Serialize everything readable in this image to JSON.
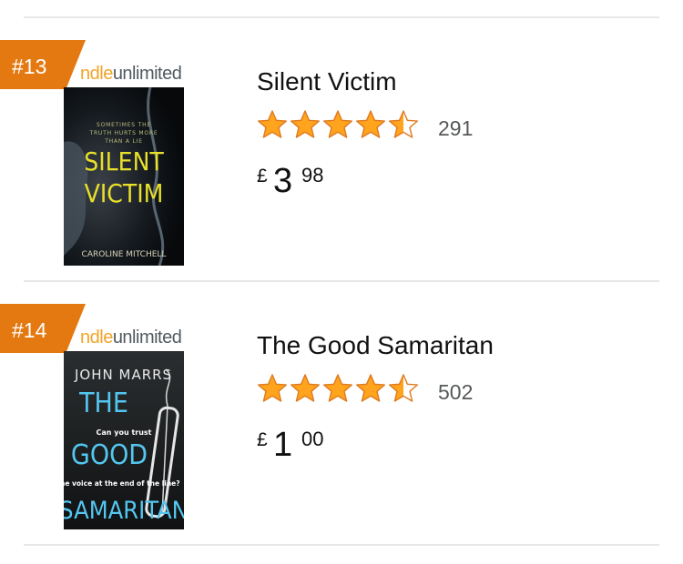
{
  "items": [
    {
      "rank": "#13",
      "kindle_unlimited": {
        "part1": "ndle",
        "part2": "unlimited"
      },
      "title": "Silent Victim",
      "rating_stars": 4.5,
      "rating_count": "291",
      "price": {
        "currency": "£",
        "whole": "3",
        "fraction": "98"
      },
      "cover": {
        "tagline": [
          "SOMETIMES THE",
          "TRUTH HURTS MORE",
          "THAN A LIE"
        ],
        "title_lines": [
          "SILENT",
          "VICTIM"
        ],
        "author": "CAROLINE MITCHELL"
      }
    },
    {
      "rank": "#14",
      "kindle_unlimited": {
        "part1": "ndle",
        "part2": "unlimited"
      },
      "title": "The Good Samaritan",
      "rating_stars": 4.5,
      "rating_count": "502",
      "price": {
        "currency": "£",
        "whole": "1",
        "fraction": "00"
      },
      "cover": {
        "author": "JOHN MARRS",
        "title_lines": [
          "THE",
          "GOOD",
          "SAMARITAN"
        ],
        "tagline1": "Can you trust",
        "tagline2": "the voice at the end of the line?"
      }
    }
  ],
  "colors": {
    "badge": "#e47911",
    "star_fill": "#ffa41c",
    "star_outline": "#de7921",
    "count": "#565959",
    "divider": "#e7e7e7"
  }
}
